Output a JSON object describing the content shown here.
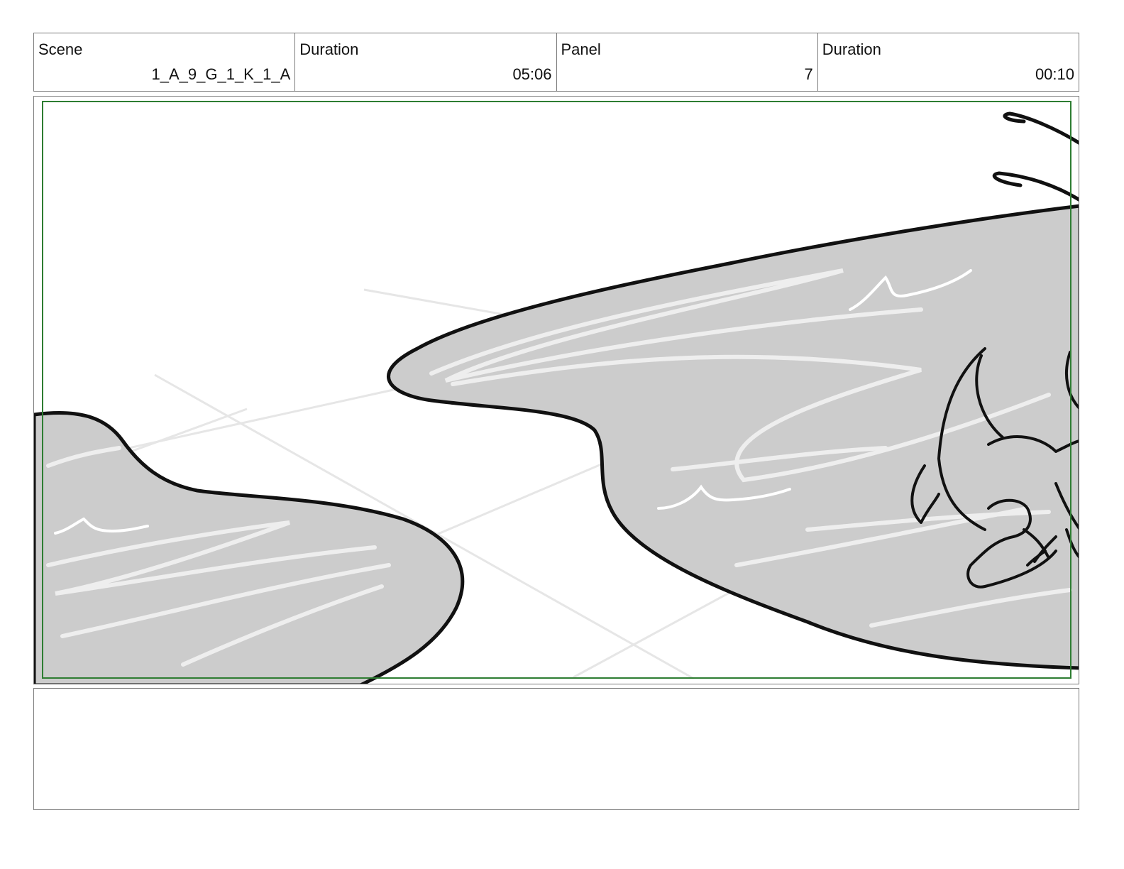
{
  "header": {
    "scene_label": "Scene",
    "scene_value": "1_A_9_G_1_K_1_A",
    "scene_duration_label": "Duration",
    "scene_duration_value": "05:06",
    "panel_label": "Panel",
    "panel_value": "7",
    "panel_duration_label": "Duration",
    "panel_duration_value": "00:10"
  },
  "panel": {
    "safe_frame_color": "#2e7d32",
    "water_fill_color": "#cccccc",
    "outline_color": "#111111"
  },
  "notes": {
    "text": ""
  }
}
